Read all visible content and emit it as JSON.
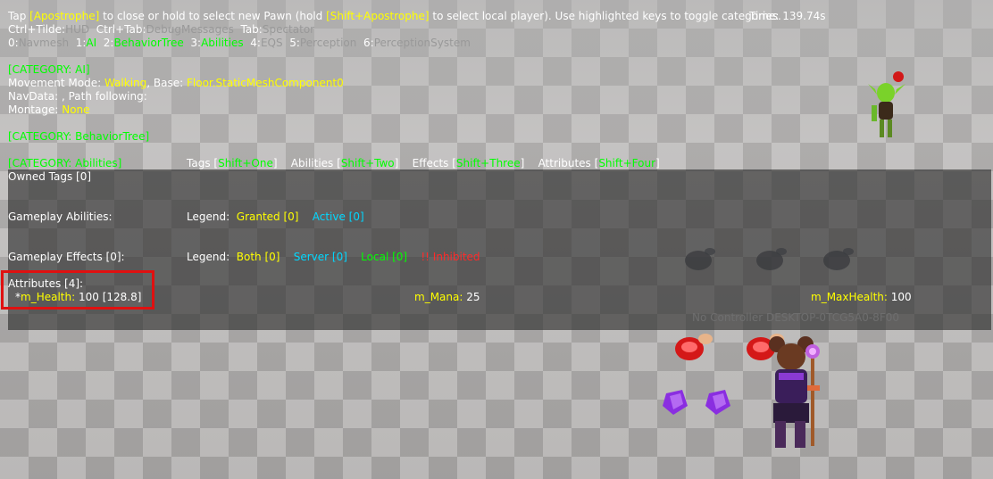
{
  "header": {
    "tap": "Tap",
    "apostrophe_key": "[Apostrophe]",
    "close_text": "to close or hold to select new Pawn (hold",
    "shift_apostrophe_key": "[Shift+Apostrophe]",
    "local_text": "to select local player). Use highlighted keys to toggle categories.",
    "time": "Time: 139.74s"
  },
  "shortcuts": [
    {
      "key": "Ctrl+Tilde:",
      "name": "HUD"
    },
    {
      "key": "Ctrl+Tab:",
      "name": "DebugMessages"
    },
    {
      "key": "Tab:",
      "name": "Spectator"
    }
  ],
  "categories": [
    {
      "key": "0:",
      "name": "Navmesh",
      "active": false
    },
    {
      "key": "1:",
      "name": "AI",
      "active": true
    },
    {
      "key": "2:",
      "name": "BehaviorTree",
      "active": true
    },
    {
      "key": "3:",
      "name": "Abilities",
      "active": true
    },
    {
      "key": "4:",
      "name": "EQS",
      "active": false
    },
    {
      "key": "5:",
      "name": "Perception",
      "active": false
    },
    {
      "key": "6:",
      "name": "PerceptionSystem",
      "active": false
    }
  ],
  "ai": {
    "category_header": "[CATEGORY: AI]",
    "movement_label": "Movement Mode:",
    "movement_value": "Walking",
    "base_label": ", Base:",
    "base_value": "Floor.StaticMeshComponent0",
    "navdata": "NavData: , Path following:",
    "montage_label": "Montage:",
    "montage_value": "None"
  },
  "behavior_tree": {
    "category_header": "[CATEGORY: BehaviorTree]"
  },
  "abilities": {
    "category_header": "[CATEGORY: Abilities]",
    "tabs": [
      {
        "label": "Tags",
        "key": "Shift+One"
      },
      {
        "label": "Abilities",
        "key": "Shift+Two"
      },
      {
        "label": "Effects",
        "key": "Shift+Three"
      },
      {
        "label": "Attributes",
        "key": "Shift+Four"
      }
    ],
    "owned_tags": "Owned Tags [0]",
    "gameplay_abilities_label": "Gameplay Abilities:",
    "abilities_legend": {
      "label": "Legend:",
      "granted": "Granted [0]",
      "active": "Active [0]"
    },
    "gameplay_effects_label": "Gameplay Effects [0]:",
    "effects_legend": {
      "label": "Legend:",
      "both": "Both [0]",
      "server": "Server [0]",
      "local": "Local [0]",
      "inhibited": "!! Inhibited"
    },
    "attributes_label": "Attributes [4]:",
    "attributes": [
      {
        "prefix": "*",
        "name": "m_Health:",
        "value": "100 [128.8]"
      },
      {
        "prefix": "",
        "name": "m_Mana:",
        "value": "25"
      },
      {
        "prefix": "",
        "name": "m_MaxHealth:",
        "value": "100"
      }
    ]
  },
  "world": {
    "no_controller_text": "No Controller DESKTOP-0TCG5A0-8F00"
  },
  "colors": {
    "key_highlight": "#ffff00",
    "active_category": "#00ff00",
    "inactive_category": "#999999",
    "highlight_box": "#e01010"
  }
}
